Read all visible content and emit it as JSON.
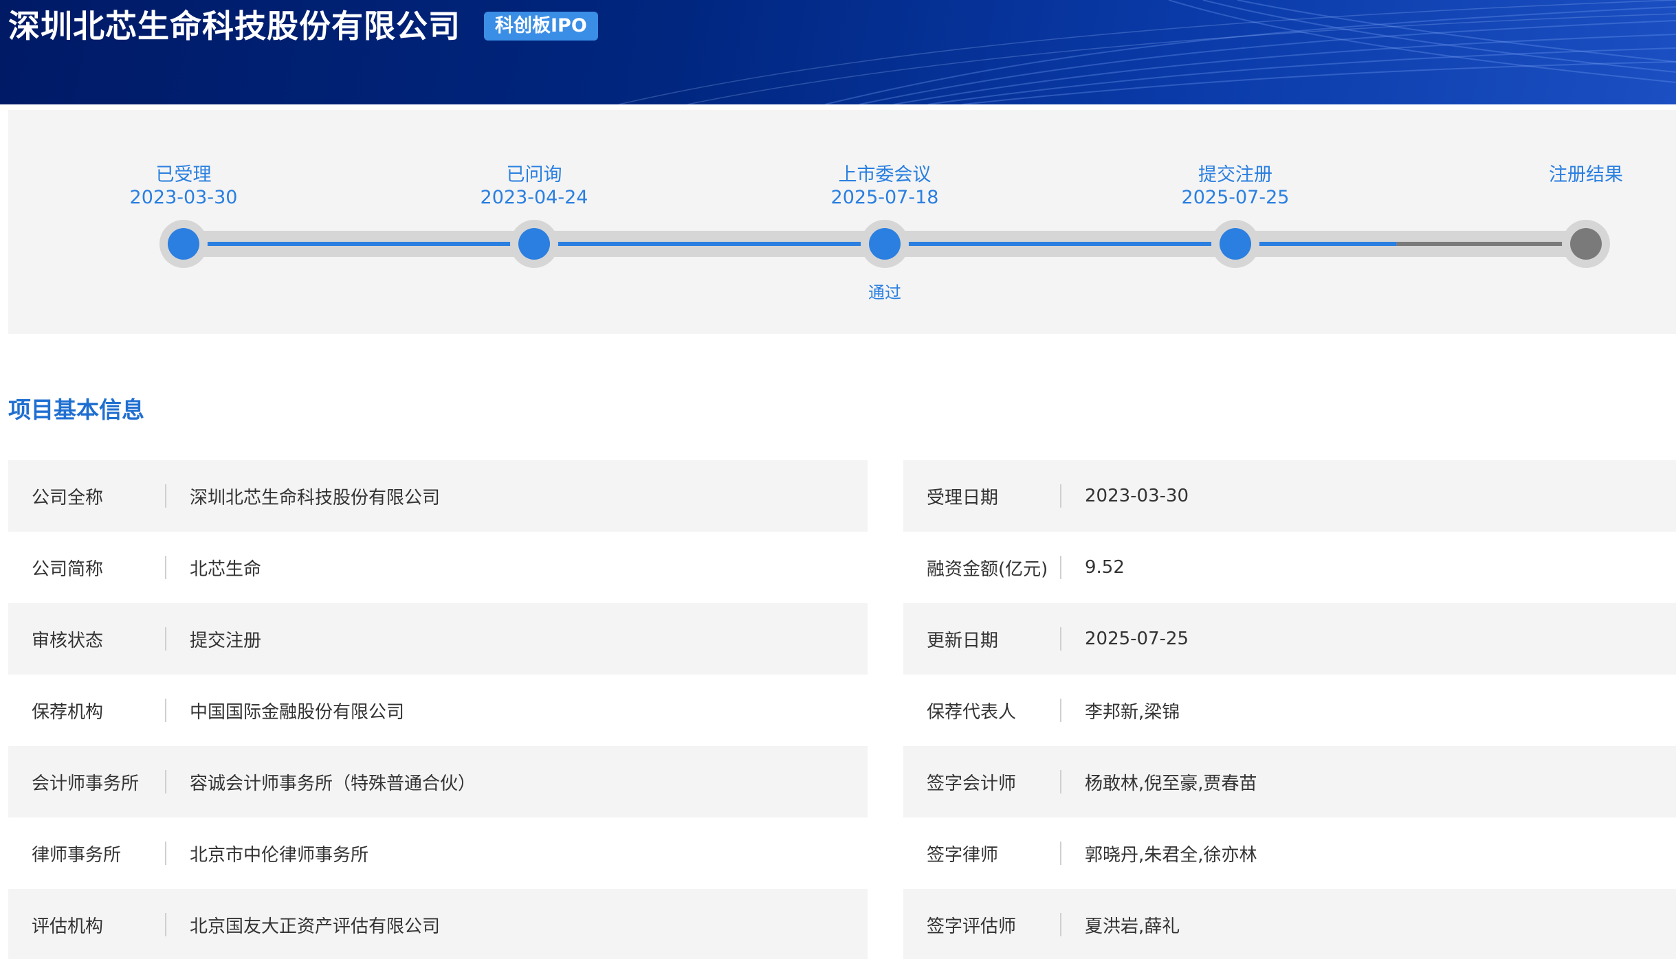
{
  "header": {
    "title": "深圳北芯生命科技股份有限公司",
    "badge": "科创板IPO",
    "colors": {
      "background": "#00267f",
      "badge": "#3a8ee6"
    }
  },
  "timeline": {
    "steps": [
      {
        "label": "已受理",
        "date": "2023-03-30",
        "status": "done"
      },
      {
        "label": "已问询",
        "date": "2023-04-24",
        "status": "done"
      },
      {
        "label": "上市委会议",
        "date": "2025-07-18",
        "status": "done",
        "note": "通过"
      },
      {
        "label": "提交注册",
        "date": "2025-07-25",
        "status": "done"
      },
      {
        "label": "注册结果",
        "date": "",
        "status": "pending"
      }
    ],
    "progress_fraction": 0.865,
    "colors": {
      "active": "#2a7fe0",
      "pending": "#7a7a7a",
      "track": "#d6d6d6"
    }
  },
  "section": {
    "title": "项目基本信息"
  },
  "info": {
    "rows": [
      {
        "left": {
          "key": "公司全称",
          "value": "深圳北芯生命科技股份有限公司"
        },
        "right": {
          "key": "受理日期",
          "value": "2023-03-30"
        }
      },
      {
        "left": {
          "key": "公司简称",
          "value": "北芯生命"
        },
        "right": {
          "key": "融资金额(亿元)",
          "value": "9.52"
        }
      },
      {
        "left": {
          "key": "审核状态",
          "value": "提交注册"
        },
        "right": {
          "key": "更新日期",
          "value": "2025-07-25"
        }
      },
      {
        "left": {
          "key": "保荐机构",
          "value": "中国国际金融股份有限公司"
        },
        "right": {
          "key": "保荐代表人",
          "value": "李邦新,梁锦"
        }
      },
      {
        "left": {
          "key": "会计师事务所",
          "value": "容诚会计师事务所（特殊普通合伙）"
        },
        "right": {
          "key": "签字会计师",
          "value": "杨敢林,倪至豪,贾春苗"
        }
      },
      {
        "left": {
          "key": "律师事务所",
          "value": "北京市中伦律师事务所"
        },
        "right": {
          "key": "签字律师",
          "value": "郭晓丹,朱君全,徐亦林"
        }
      },
      {
        "left": {
          "key": "评估机构",
          "value": "北京国友大正资产评估有限公司"
        },
        "right": {
          "key": "签字评估师",
          "value": "夏洪岩,薛礼"
        }
      }
    ]
  }
}
